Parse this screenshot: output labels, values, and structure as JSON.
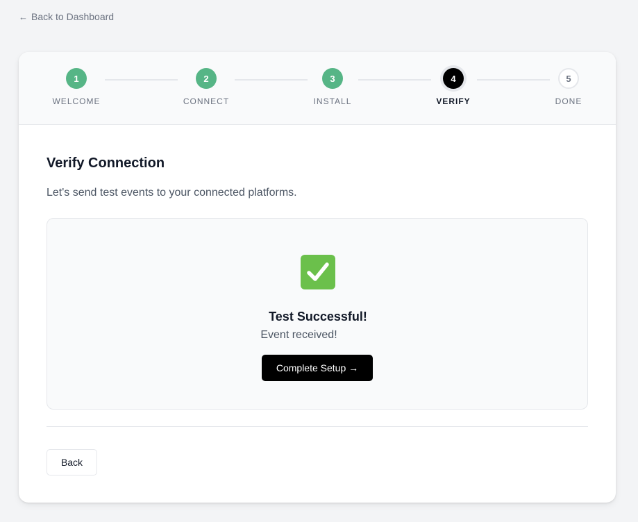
{
  "nav": {
    "back_label": "Back to Dashboard"
  },
  "stepper": {
    "steps": [
      {
        "number": "1",
        "label": "WELCOME",
        "status": "done"
      },
      {
        "number": "2",
        "label": "CONNECT",
        "status": "done"
      },
      {
        "number": "3",
        "label": "INSTALL",
        "status": "done"
      },
      {
        "number": "4",
        "label": "VERIFY",
        "status": "active"
      },
      {
        "number": "5",
        "label": "DONE",
        "status": "pending"
      }
    ]
  },
  "main": {
    "title": "Verify Connection",
    "subtitle": "Let's send test events to your connected platforms.",
    "result": {
      "icon": "check-mark-icon",
      "title": "Test Successful!",
      "message": "Event received!",
      "complete_label": "Complete Setup →"
    },
    "back_label": "Back"
  },
  "colors": {
    "success": "#56b586",
    "active": "#000000",
    "check_green": "#6bc04b"
  }
}
